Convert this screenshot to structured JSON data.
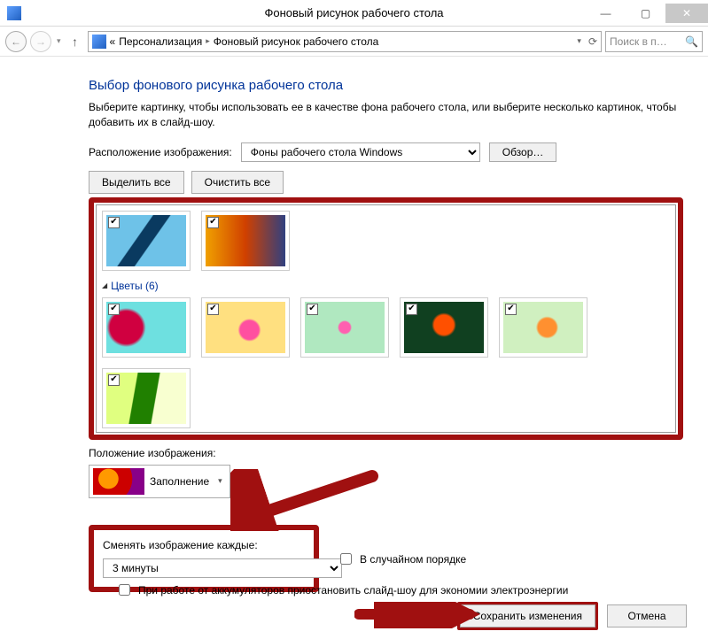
{
  "window": {
    "title": "Фоновый рисунок рабочего стола",
    "min": "—",
    "max": "▢",
    "close": "✕"
  },
  "nav": {
    "back": "←",
    "fwd": "→",
    "up": "↑",
    "chev": "▾",
    "crumb_root": "«",
    "crumb1": "Персонализация",
    "crumb2": "Фоновый рисунок рабочего стола",
    "sep": "▸",
    "refresh": "⟳",
    "search_placeholder": "Поиск в п…",
    "mag": "🔍"
  },
  "page": {
    "heading": "Выбор фонового рисунка рабочего стола",
    "sub": "Выберите картинку, чтобы использовать ее в качестве фона рабочего стола, или выберите несколько картинок, чтобы добавить их в слайд-шоу.",
    "location_label": "Расположение изображения:",
    "location_value": "Фоны рабочего стола Windows",
    "browse": "Обзор…",
    "select_all": "Выделить все",
    "clear_all": "Очистить все",
    "group_flowers": "Цветы (6)",
    "position_label": "Положение изображения:",
    "position_value": "Заполнение",
    "change_label": "Сменять изображение каждые:",
    "change_value": "3 минуты",
    "random": "В случайном порядке",
    "battery": "При работе от аккумуляторов приостановить слайд-шоу для экономии электроэнергии",
    "save": "Сохранить изменения",
    "cancel": "Отмена"
  },
  "thumbs_top": [
    {
      "checked": true,
      "bg": "bg1"
    },
    {
      "checked": true,
      "bg": "bg2"
    }
  ],
  "thumbs_flowers": [
    {
      "checked": true,
      "bg": "bgf1"
    },
    {
      "checked": true,
      "bg": "bgf2"
    },
    {
      "checked": true,
      "bg": "bgf3"
    },
    {
      "checked": true,
      "bg": "bgf4"
    },
    {
      "checked": true,
      "bg": "bgf5"
    },
    {
      "checked": true,
      "bg": "bgf6"
    }
  ]
}
